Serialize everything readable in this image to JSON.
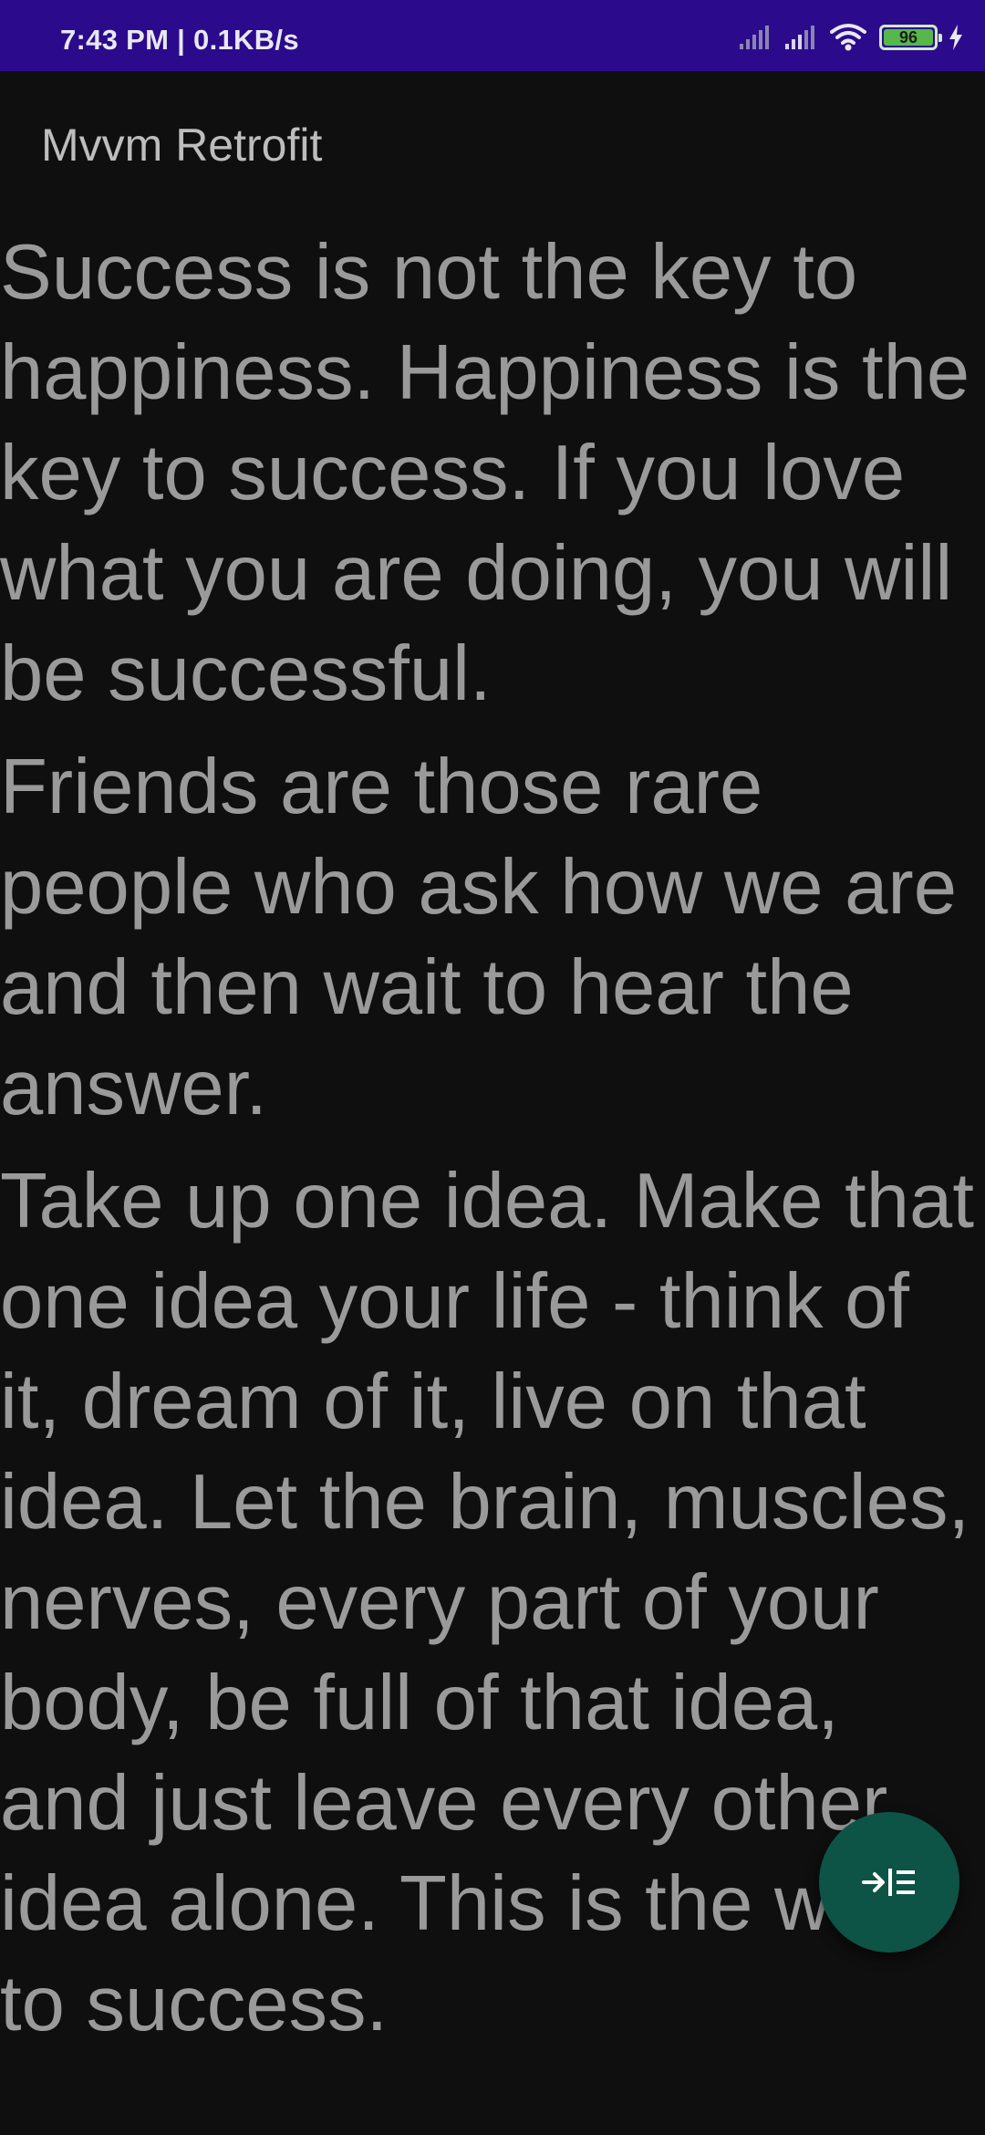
{
  "status_bar": {
    "time": "7:43 PM | 0.1KB/s",
    "battery_level": "96",
    "icons": [
      "signal-icon",
      "signal-icon",
      "wifi-icon",
      "battery-icon",
      "charging-bolt-icon"
    ]
  },
  "app_bar": {
    "title": "Mvvm Retrofit"
  },
  "quotes": [
    {
      "text": "Success is not the key to happiness. Happiness is the key to success. If you love what you are doing, you will be successful."
    },
    {
      "text": "Friends are those rare people who ask how we are and then wait to hear the answer."
    },
    {
      "text": "Take up one idea. Make that one idea your life - think of it, dream of it, live on that idea. Let the brain, muscles, nerves, every part of your body, be full of that idea, and just leave every other idea alone. This is the way to success."
    }
  ],
  "fab": {
    "icon": "format-indent-icon"
  },
  "colors": {
    "status_bar": "#2c0a8c",
    "background": "#0f0f0f",
    "quote_text": "#9a9a9a",
    "fab": "#0d5446"
  }
}
